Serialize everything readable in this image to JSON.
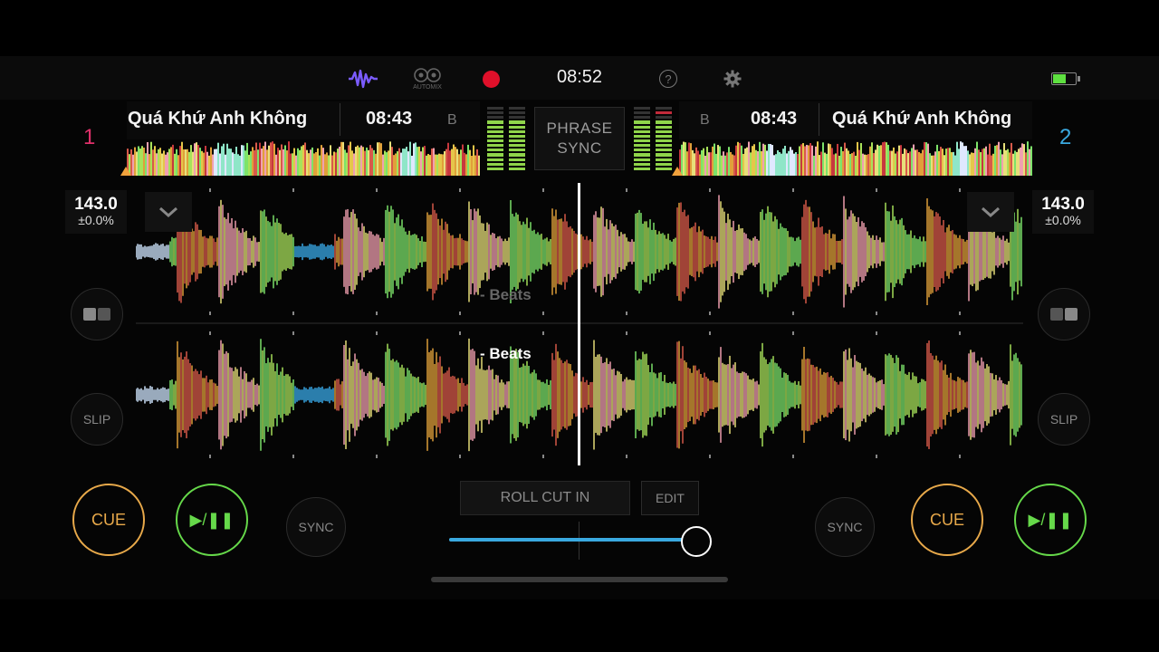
{
  "topbar": {
    "clock": "08:52",
    "automix_label": "AUTOMIX",
    "icons": [
      "waveform-icon",
      "automix-icon",
      "record-icon",
      "help-icon",
      "gear-icon",
      "battery-icon"
    ]
  },
  "deck1": {
    "number": "1",
    "title": "Quá Khứ Anh Không",
    "time": "08:43",
    "b_label": "B",
    "bpm": "143.0",
    "pitch": "±0.0%",
    "number_color": "#e0306a"
  },
  "deck2": {
    "number": "2",
    "title": "Quá Khứ Anh Không",
    "time": "08:43",
    "b_label": "B",
    "bpm": "143.0",
    "pitch": "±0.0%",
    "number_color": "#3aa9e0"
  },
  "center": {
    "phrase_sync": "PHRASE SYNC",
    "beats_upper": "- Beats",
    "beats_lower": "- Beats"
  },
  "controls": {
    "slip_label": "SLIP",
    "sync_label": "SYNC",
    "cue_label": "CUE",
    "play_label": "▶/❚❚",
    "fx_mode": "ROLL CUT IN",
    "edit_label": "EDIT",
    "crossfader_position": 0.99
  },
  "colors": {
    "cue": "#e8a94a",
    "play": "#66d94a",
    "accent_blue": "#3aa9e0",
    "record": "#e0102a",
    "waveform_icon": "#7b5cff"
  }
}
